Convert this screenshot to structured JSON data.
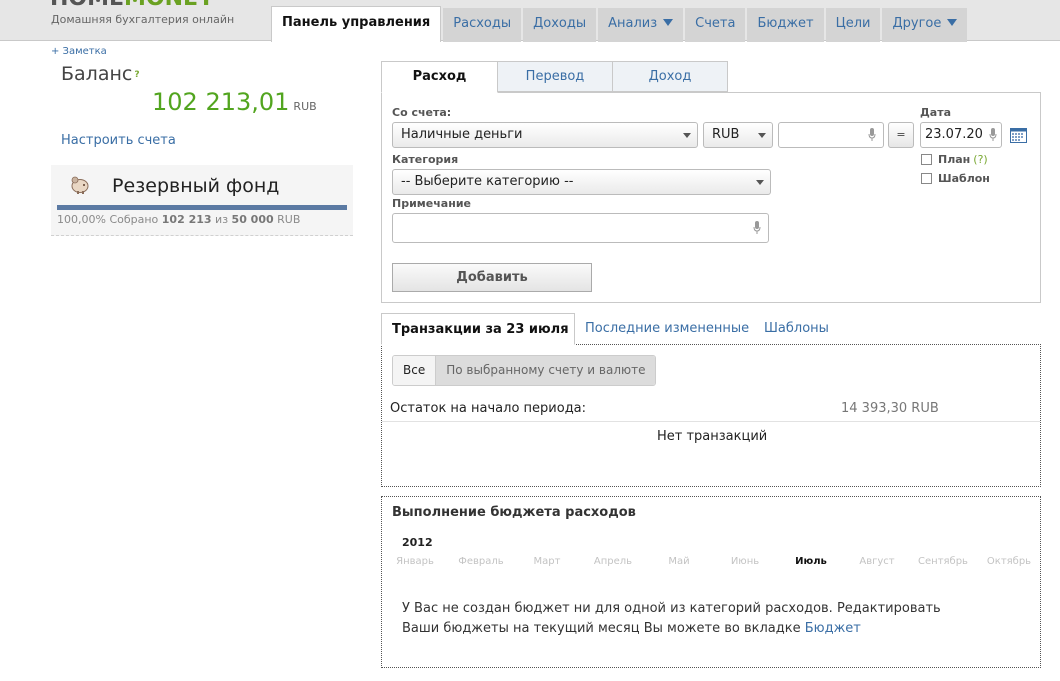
{
  "header": {
    "logo_part1": "HOME",
    "logo_part2": "MONEY",
    "tagline": "Домашняя бухгалтерия онлайн",
    "nav": [
      {
        "label": "Панель управления",
        "active": true
      },
      {
        "label": "Расходы"
      },
      {
        "label": "Доходы"
      },
      {
        "label": "Анализ",
        "dropdown": true
      },
      {
        "label": "Счета"
      },
      {
        "label": "Бюджет"
      },
      {
        "label": "Цели"
      },
      {
        "label": "Другое",
        "dropdown": true
      }
    ]
  },
  "sidebar": {
    "note_link": "+ Заметка",
    "balance_title": "Баланс",
    "balance_help": "?",
    "balance_amount": "102 213,01",
    "balance_currency": "RUB",
    "setup_link": "Настроить счета",
    "fund": {
      "name": "Резервный фонд",
      "progress_percent": 100,
      "stats_percent": "100,00% Собрано",
      "stats_collected": "102 213",
      "stats_of": "из",
      "stats_target": "50 000",
      "stats_currency": "RUB"
    }
  },
  "entry": {
    "tabs": [
      {
        "label": "Расход",
        "active": true
      },
      {
        "label": "Перевод"
      },
      {
        "label": "Доход"
      }
    ],
    "from_account_label": "Со счета:",
    "account_value": "Наличные деньги",
    "currency_value": "RUB",
    "amount_value": "",
    "equals_label": "=",
    "date_label": "Дата",
    "date_value": "23.07.20",
    "category_label": "Категория",
    "category_value": "-- Выберите категорию --",
    "plan_label": "План",
    "plan_help": "(?)",
    "template_label": "Шаблон",
    "note_label": "Примечание",
    "note_value": "",
    "add_button": "Добавить"
  },
  "transactions": {
    "tabs": [
      {
        "label": "Транзакции за 23 июля",
        "active": true
      },
      {
        "label": "Последние измененные"
      },
      {
        "label": "Шаблоны"
      }
    ],
    "filters": [
      {
        "label": "Все",
        "active": true
      },
      {
        "label": "По выбранному счету и валюте"
      }
    ],
    "start_label": "Остаток на начало периода:",
    "start_amount": "14 393,30 RUB",
    "empty_text": "Нет транзакций"
  },
  "budget": {
    "title": "Выполнение бюджета расходов",
    "year": "2012",
    "months": [
      "Январь",
      "Февраль",
      "Март",
      "Апрель",
      "Май",
      "Июнь",
      "Июль",
      "Август",
      "Сентябрь",
      "Октябрь"
    ],
    "active_month": "Июль",
    "message_line1": "У Вас не создан бюджет ни для одной из категорий расходов. Редактировать",
    "message_line2": "Ваши бюджеты на текущий месяц Вы можете во вкладке",
    "message_link": "Бюджет"
  },
  "colors": {
    "accent_blue": "#3a6ea5",
    "balance_green": "#52a51f",
    "progress_blue": "#5b7aa3"
  }
}
